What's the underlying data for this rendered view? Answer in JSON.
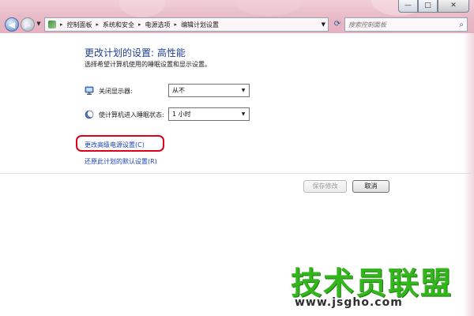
{
  "window": {
    "minimize_glyph": "—",
    "maximize_glyph": "□",
    "close_glyph": "✕"
  },
  "address_bar": {
    "breadcrumbs": [
      "控制面板",
      "系统和安全",
      "电源选项",
      "编辑计划设置"
    ],
    "separator": "▸"
  },
  "search": {
    "placeholder": "搜索控制面板"
  },
  "main": {
    "title": "更改计划的设置: 高性能",
    "subtitle": "选择希望计算机使用的睡眠设置和显示设置。",
    "settings": [
      {
        "label": "关闭显示器:",
        "value": "从不",
        "icon": "monitor-icon"
      },
      {
        "label": "使计算机进入睡眠状态:",
        "value": "1 小时",
        "icon": "moon-sleep-icon"
      }
    ],
    "links": {
      "advanced": "更改高级电源设置(C)",
      "restore": "还原此计划的默认设置(R)"
    }
  },
  "buttons": {
    "save": "保存修改",
    "cancel": "取消"
  },
  "watermark": {
    "brand": "技术员联盟",
    "url": "www.jsgho.com"
  },
  "colors": {
    "title_blue": "#1e3f8f",
    "link_blue": "#1d43b3",
    "highlight_red": "#e0001a",
    "watermark_green": "#33b61c",
    "titlebar_pink": "#e8b9c7"
  }
}
